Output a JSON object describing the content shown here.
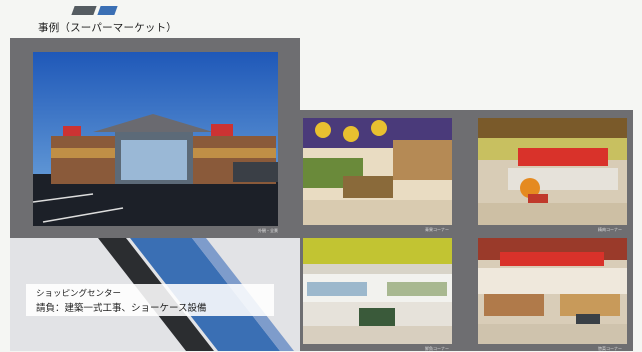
{
  "slide": {
    "title": "事例（スーパーマーケット）",
    "colors": {
      "accent_gray": "#555c61",
      "accent_blue": "#3a6fb4",
      "panel": "#6e6e71"
    }
  },
  "photos": [
    {
      "id": "exterior",
      "caption": "外観・全景"
    },
    {
      "id": "interior-1",
      "caption": "青果コーナー"
    },
    {
      "id": "interior-2",
      "caption": "精肉コーナー"
    },
    {
      "id": "interior-3",
      "caption": "鮮魚コーナー"
    },
    {
      "id": "interior-4",
      "caption": "惣菜コーナー"
    }
  ],
  "info": {
    "line1": "ショッピングセンター",
    "line2": "請負：建築一式工事、ショーケース設備"
  }
}
